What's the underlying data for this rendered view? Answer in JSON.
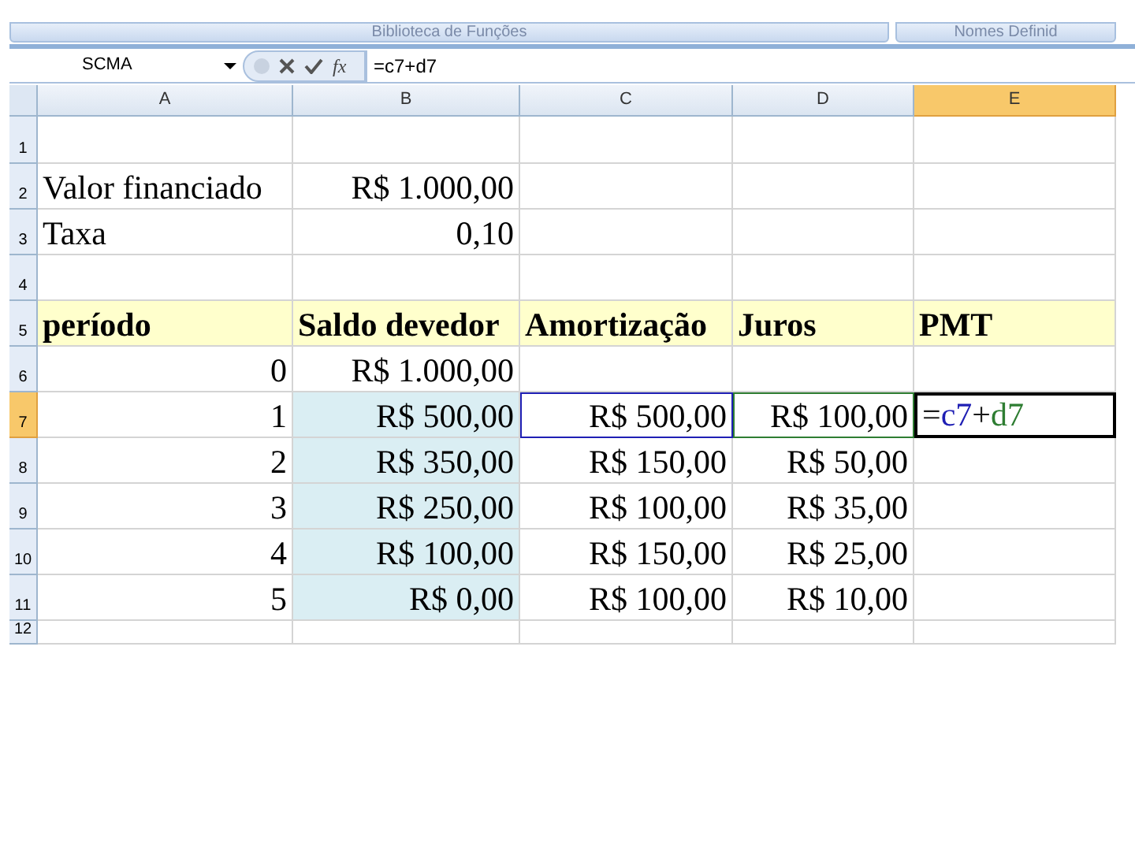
{
  "ribbon": {
    "groups": [
      "Biblioteca de Funções",
      "Nomes Definid"
    ]
  },
  "formula_bar": {
    "name_box": "SCMA",
    "fx": "fx",
    "formula": "=c7+d7"
  },
  "columns": [
    {
      "label": "A",
      "selected": false
    },
    {
      "label": "B",
      "selected": false
    },
    {
      "label": "C",
      "selected": false
    },
    {
      "label": "D",
      "selected": false
    },
    {
      "label": "E",
      "selected": true
    }
  ],
  "rows": [
    {
      "number": "1",
      "selected": false,
      "kind": "plain",
      "cells": [
        {
          "kind": "value"
        },
        {
          "kind": "value"
        },
        {
          "kind": "value"
        },
        {
          "kind": "value"
        },
        {
          "kind": "value"
        }
      ]
    },
    {
      "number": "2",
      "selected": false,
      "kind": "plain",
      "cells": [
        {
          "kind": "value",
          "text": "Valor financiado"
        },
        {
          "kind": "value",
          "text": "R$ 1.000,00"
        },
        {
          "kind": "value"
        },
        {
          "kind": "value"
        },
        {
          "kind": "value"
        }
      ]
    },
    {
      "number": "3",
      "selected": false,
      "kind": "plain",
      "cells": [
        {
          "kind": "value",
          "text": "Taxa"
        },
        {
          "kind": "value",
          "text": "0,10"
        },
        {
          "kind": "value"
        },
        {
          "kind": "value"
        },
        {
          "kind": "value"
        }
      ]
    },
    {
      "number": "4",
      "selected": false,
      "kind": "plain",
      "cells": [
        {
          "kind": "value"
        },
        {
          "kind": "value"
        },
        {
          "kind": "value"
        },
        {
          "kind": "value"
        },
        {
          "kind": "value"
        }
      ]
    },
    {
      "number": "5",
      "selected": false,
      "kind": "header",
      "cells": [
        {
          "kind": "value",
          "text": "período"
        },
        {
          "kind": "value",
          "text": "Saldo devedor"
        },
        {
          "kind": "value",
          "text": "Amortização"
        },
        {
          "kind": "value",
          "text": "Juros"
        },
        {
          "kind": "value",
          "text": "PMT"
        }
      ]
    },
    {
      "number": "6",
      "selected": false,
      "kind": "plain",
      "cells": [
        {
          "kind": "value",
          "text": "0"
        },
        {
          "kind": "value",
          "text": "R$ 1.000,00"
        },
        {
          "kind": "value"
        },
        {
          "kind": "value"
        },
        {
          "kind": "value"
        }
      ]
    },
    {
      "number": "7",
      "selected": true,
      "kind": "shaded",
      "cells": [
        {
          "kind": "value",
          "text": "1"
        },
        {
          "kind": "value",
          "text": "R$ 500,00"
        },
        {
          "kind": "reference",
          "text": "R$ 500,00",
          "color": "#1f1fb4"
        },
        {
          "kind": "reference",
          "text": "R$ 100,00",
          "color": "#2e7d32"
        },
        {
          "kind": "editing",
          "tokens": [
            {
              "text": "=",
              "color": "#1a1a1a"
            },
            {
              "text": "c7",
              "color": "#1f1fb4"
            },
            {
              "text": "+",
              "color": "#1a1a1a"
            },
            {
              "text": "d7",
              "color": "#2e7d32"
            }
          ]
        }
      ]
    },
    {
      "number": "8",
      "selected": false,
      "kind": "shaded",
      "cells": [
        {
          "kind": "value",
          "text": "2"
        },
        {
          "kind": "value",
          "text": "R$ 350,00"
        },
        {
          "kind": "value",
          "text": "R$ 150,00"
        },
        {
          "kind": "value",
          "text": "R$ 50,00"
        },
        {
          "kind": "value"
        }
      ]
    },
    {
      "number": "9",
      "selected": false,
      "kind": "shaded",
      "cells": [
        {
          "kind": "value",
          "text": "3"
        },
        {
          "kind": "value",
          "text": "R$ 250,00"
        },
        {
          "kind": "value",
          "text": "R$ 100,00"
        },
        {
          "kind": "value",
          "text": "R$ 35,00"
        },
        {
          "kind": "value"
        }
      ]
    },
    {
      "number": "10",
      "selected": false,
      "kind": "shaded",
      "cells": [
        {
          "kind": "value",
          "text": "4"
        },
        {
          "kind": "value",
          "text": "R$ 100,00"
        },
        {
          "kind": "value",
          "text": "R$ 150,00"
        },
        {
          "kind": "value",
          "text": "R$ 25,00"
        },
        {
          "kind": "value"
        }
      ]
    },
    {
      "number": "11",
      "selected": false,
      "kind": "shaded",
      "cells": [
        {
          "kind": "value",
          "text": "5"
        },
        {
          "kind": "value",
          "text": "R$ 0,00"
        },
        {
          "kind": "value",
          "text": "R$ 100,00"
        },
        {
          "kind": "value",
          "text": "R$ 10,00"
        },
        {
          "kind": "value"
        }
      ]
    },
    {
      "number": "12",
      "selected": false,
      "kind": "plain",
      "cells": [
        {
          "kind": "value"
        },
        {
          "kind": "value"
        },
        {
          "kind": "value"
        },
        {
          "kind": "value"
        },
        {
          "kind": "value"
        }
      ]
    }
  ]
}
